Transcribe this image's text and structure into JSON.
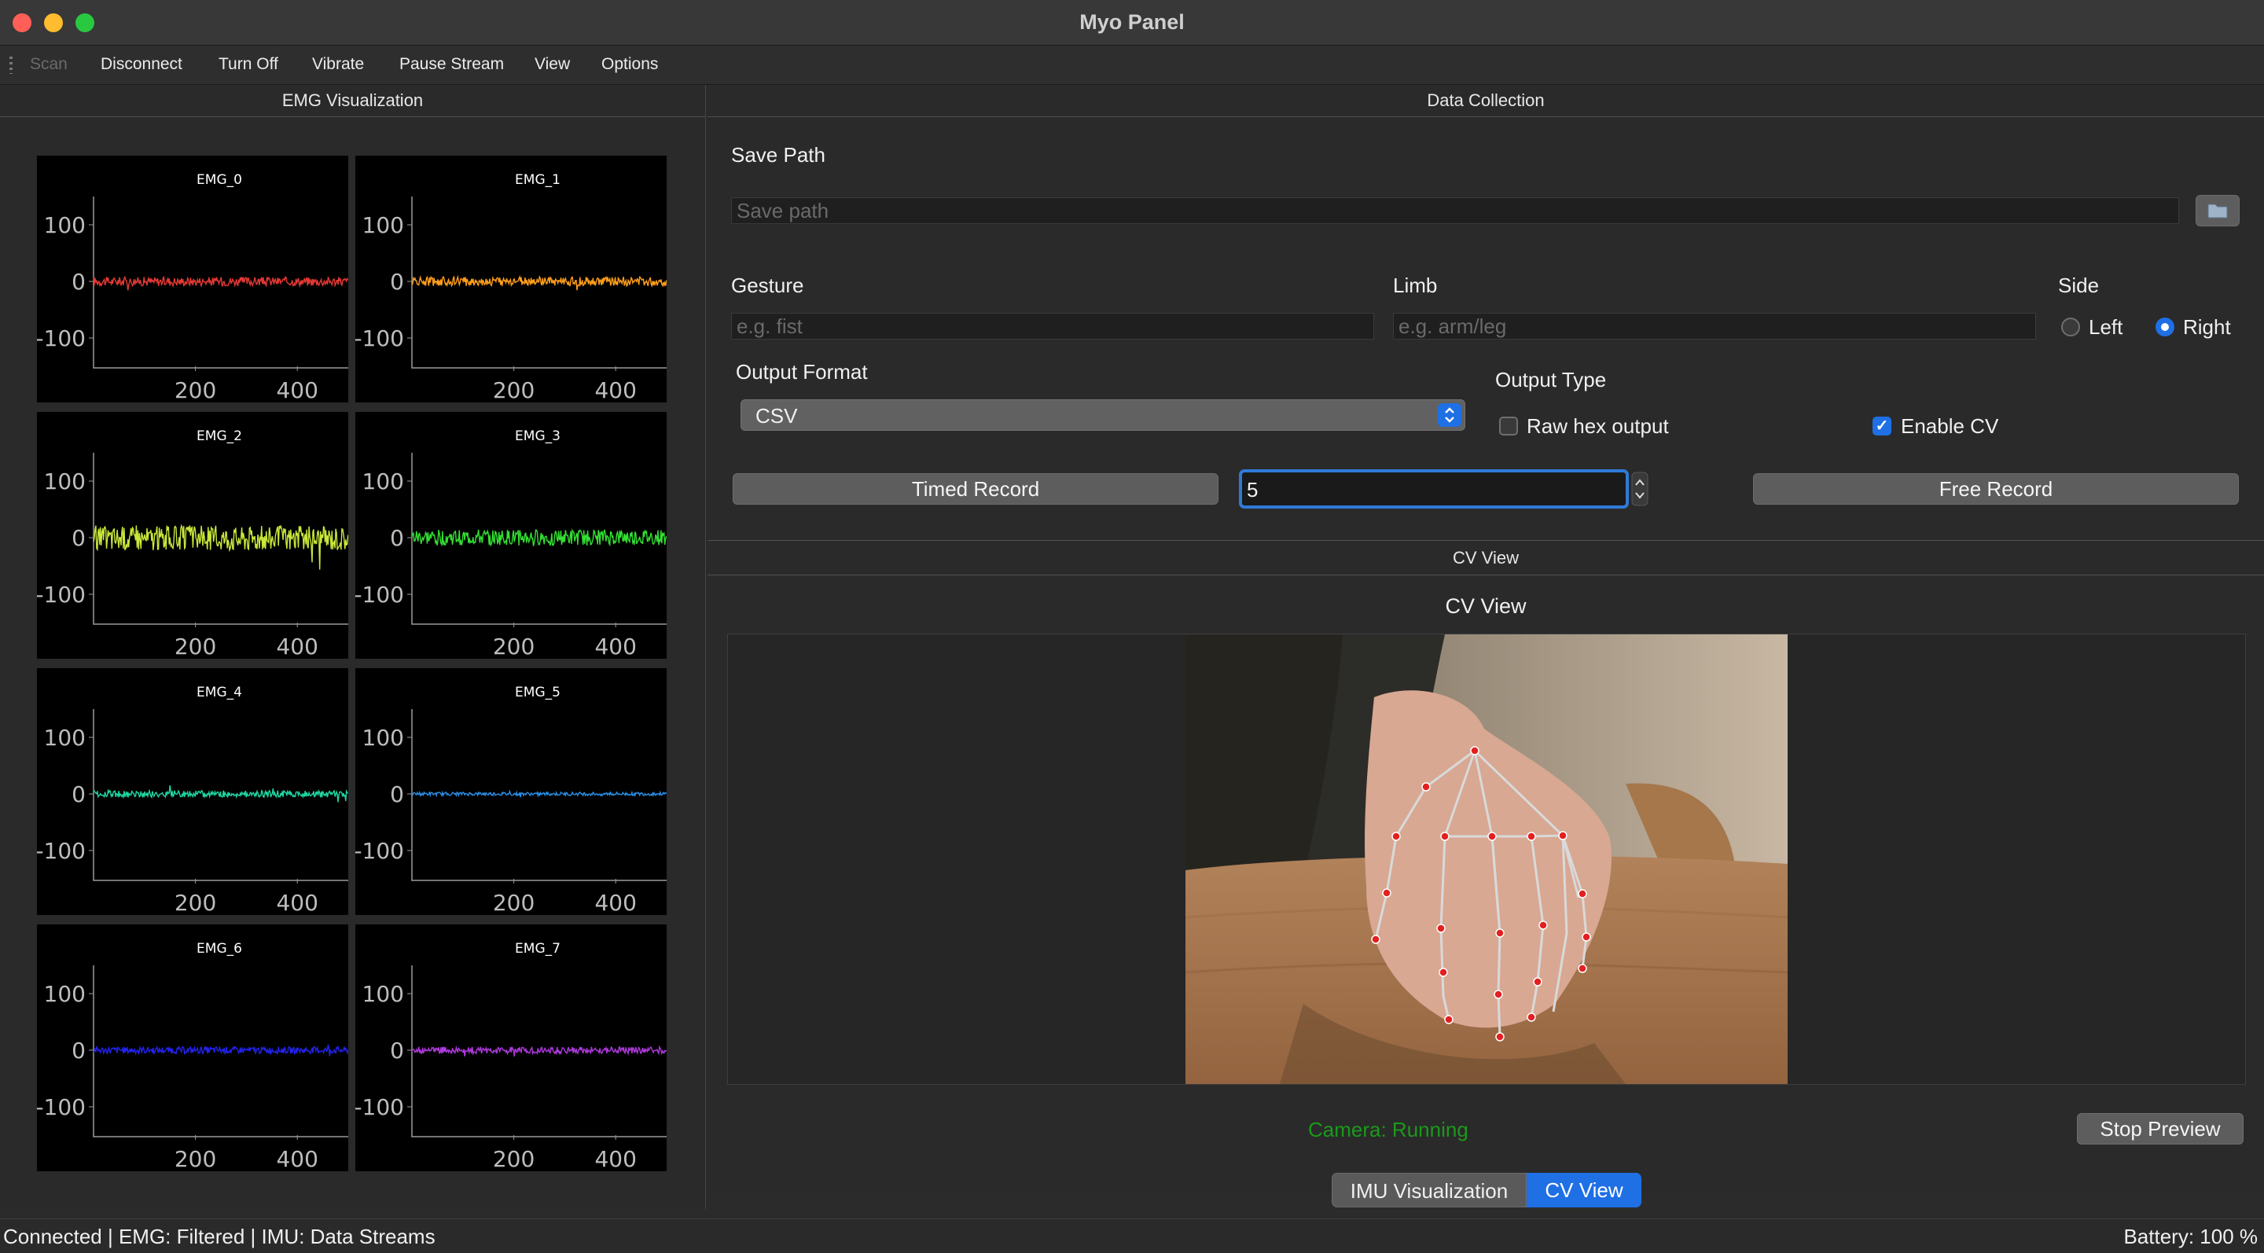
{
  "window": {
    "title": "Myo Panel"
  },
  "toolbar": {
    "scan": "Scan",
    "disconnect": "Disconnect",
    "turn_off": "Turn Off",
    "vibrate": "Vibrate",
    "pause_stream": "Pause Stream",
    "view": "View",
    "options": "Options"
  },
  "left_panel": {
    "title": "EMG Visualization",
    "y_ticks": [
      "100",
      "0",
      "-100"
    ],
    "x_ticks": [
      "200",
      "400"
    ]
  },
  "chart_data": [
    {
      "type": "line",
      "title": "EMG_0",
      "color": "#e53935",
      "amplitude": 8,
      "x": [
        0,
        500
      ],
      "ylim": [
        -150,
        150
      ]
    },
    {
      "type": "line",
      "title": "EMG_1",
      "color": "#ff9f1c",
      "amplitude": 8,
      "x": [
        0,
        500
      ],
      "ylim": [
        -150,
        150
      ]
    },
    {
      "type": "line",
      "title": "EMG_2",
      "color": "#c8e83a",
      "amplitude": 22,
      "x": [
        0,
        500
      ],
      "ylim": [
        -150,
        150
      ]
    },
    {
      "type": "line",
      "title": "EMG_3",
      "color": "#33e033",
      "amplitude": 14,
      "x": [
        0,
        500
      ],
      "ylim": [
        -150,
        150
      ]
    },
    {
      "type": "line",
      "title": "EMG_4",
      "color": "#20d7a3",
      "amplitude": 6,
      "x": [
        0,
        500
      ],
      "ylim": [
        -150,
        150
      ]
    },
    {
      "type": "line",
      "title": "EMG_5",
      "color": "#2b8fe6",
      "amplitude": 3,
      "x": [
        0,
        500
      ],
      "ylim": [
        -150,
        150
      ]
    },
    {
      "type": "line",
      "title": "EMG_6",
      "color": "#2323ee",
      "amplitude": 6,
      "x": [
        0,
        500
      ],
      "ylim": [
        -150,
        150
      ]
    },
    {
      "type": "line",
      "title": "EMG_7",
      "color": "#b03adf",
      "amplitude": 6,
      "x": [
        0,
        500
      ],
      "ylim": [
        -150,
        150
      ]
    }
  ],
  "data_collection": {
    "title": "Data Collection",
    "save_path_label": "Save Path",
    "save_path_placeholder": "Save path",
    "gesture_label": "Gesture",
    "gesture_placeholder": "e.g. fist",
    "limb_label": "Limb",
    "limb_placeholder": "e.g. arm/leg",
    "side_label": "Side",
    "side_left": "Left",
    "side_right": "Right",
    "side_selected": "Right",
    "output_format_label": "Output Format",
    "output_format_value": "CSV",
    "output_type_label": "Output Type",
    "raw_hex_label": "Raw hex output",
    "raw_hex_checked": false,
    "enable_cv_label": "Enable CV",
    "enable_cv_checked": true,
    "timed_record": "Timed Record",
    "duration_value": "5",
    "free_record": "Free Record"
  },
  "cv_view": {
    "header": "CV View",
    "title": "CV View",
    "camera_status": "Camera: Running",
    "stop_preview": "Stop Preview"
  },
  "bottom_tabs": {
    "imu": "IMU Visualization",
    "cv": "CV View",
    "active": "CV View"
  },
  "status_bar": {
    "left": "Connected | EMG: Filtered | IMU: Data Streams",
    "right": "Battery: 100 %"
  },
  "colors": {
    "accent": "#1f6fe5",
    "camera_status": "#1a9a1a"
  }
}
